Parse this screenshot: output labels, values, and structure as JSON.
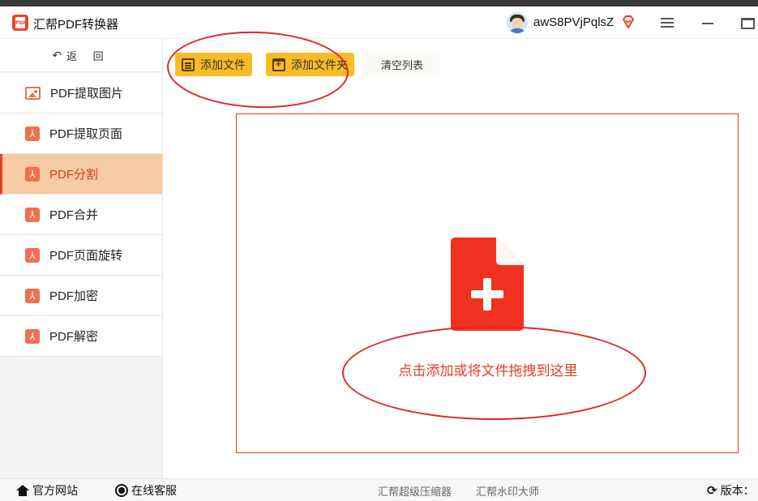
{
  "app": {
    "title": "汇帮PDF转换器",
    "username": "awS8PVjPqlsZ",
    "icons": {
      "logo": "pdf-logo-icon",
      "avatar": "user-avatar",
      "vip": "vip-diamond-icon",
      "menu": "hamburger-menu-icon",
      "minimize": "minimize-icon",
      "maximize": "maximize-icon"
    }
  },
  "sidebar": {
    "back_label": "返 回",
    "back_icon": "back-arrow-icon",
    "active_index": 2,
    "items": [
      {
        "label": "PDF提取图片",
        "icon": "image-icon"
      },
      {
        "label": "PDF提取页面",
        "icon": "pdf-icon"
      },
      {
        "label": "PDF分割",
        "icon": "pdf-icon"
      },
      {
        "label": "PDF合并",
        "icon": "pdf-icon"
      },
      {
        "label": "PDF页面旋转",
        "icon": "pdf-icon"
      },
      {
        "label": "PDF加密",
        "icon": "pdf-icon"
      },
      {
        "label": "PDF解密",
        "icon": "pdf-icon"
      }
    ]
  },
  "toolbar": {
    "add_file_label": "添加文件",
    "add_folder_label": "添加文件夹",
    "clear_list_label": "清空列表"
  },
  "dropzone": {
    "hint": "点击添加或将文件拖拽到这里",
    "icon": "file-add-icon"
  },
  "bottombar": {
    "website": "官方网站",
    "support": "在线客服",
    "compressor": "汇帮超级压缩器",
    "watermark": "汇帮水印大师",
    "version_label": "版本："
  },
  "colors": {
    "accent": "#e8452a",
    "active_bg": "#f7cba4",
    "button_yellow": "#f9bc26",
    "annotation_red": "#e02828"
  }
}
